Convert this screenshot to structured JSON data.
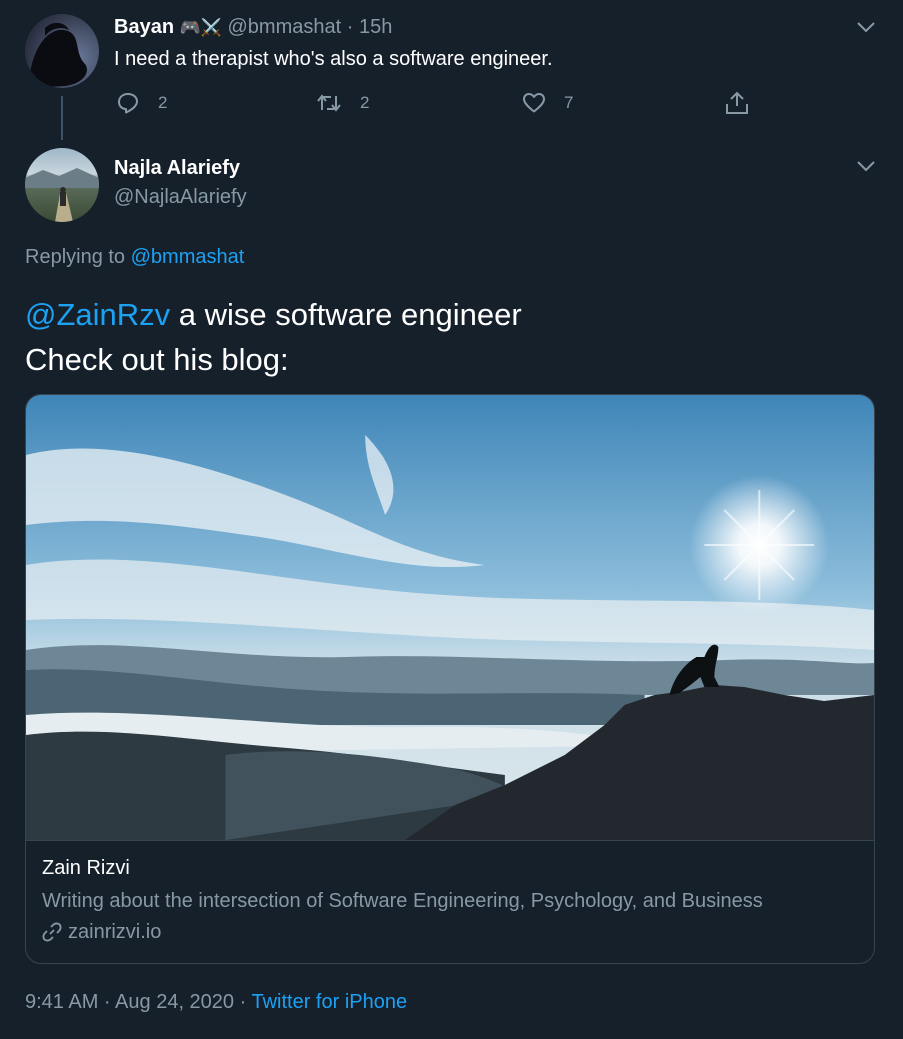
{
  "tweet1": {
    "name": "Bayan",
    "emoji": "🎮⚔️",
    "handle": "@bmmashat",
    "time": "· 15h",
    "text": "I need a therapist who's also a software engineer.",
    "reply_count": "2",
    "retweet_count": "2",
    "like_count": "7"
  },
  "tweet2": {
    "name": "Najla Alariefy",
    "handle": "@NajlaAlariefy",
    "replying_prefix": "Replying to",
    "replying_handle": "@bmmashat",
    "mention": "@ZainRzv",
    "text_line1_rest": " a wise software engineer",
    "text_line2": "Check out his blog:",
    "card": {
      "title": "Zain Rizvi",
      "description": "Writing about the intersection of Software Engineering, Psychology, and Business",
      "domain": "zainrizvi.io"
    },
    "timestamp": "9:41 AM · Aug 24, 2020 ·",
    "source": "Twitter for iPhone"
  },
  "colors": {
    "background": "#15202b",
    "accent": "#1da1f2",
    "muted": "#8899a6",
    "border": "#38444d"
  },
  "icons": [
    "chevron-down-icon",
    "reply-icon",
    "retweet-icon",
    "like-icon",
    "share-icon",
    "link-icon"
  ]
}
